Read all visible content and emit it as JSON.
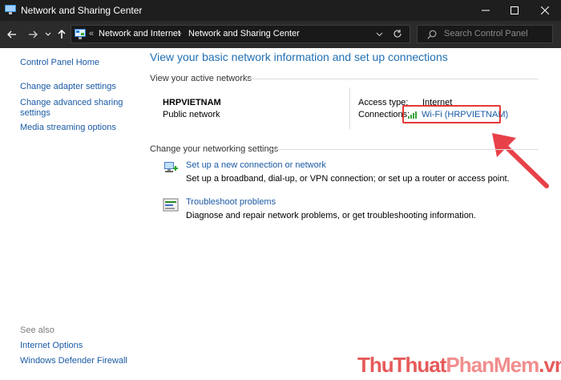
{
  "window": {
    "title": "Network and Sharing Center"
  },
  "address_bar": {
    "crumb_sep": "«",
    "crumbs": [
      "Network and Internet",
      "Network and Sharing Center"
    ],
    "search_placeholder": "Search Control Panel"
  },
  "sidebar": {
    "links": [
      "Control Panel Home",
      "Change adapter settings",
      "Change advanced sharing",
      "settings",
      "Media streaming options"
    ],
    "see_also_label": "See also",
    "see_also": [
      "Internet Options",
      "Windows Defender Firewall"
    ]
  },
  "main": {
    "heading": "View your basic network information and set up connections",
    "active_networks_label": "View your active networks",
    "network_name": "HRPVIETNAM",
    "network_type": "Public network",
    "access_type_label": "Access type:",
    "access_type_value": "Internet",
    "connections_label": "Connections:",
    "connection_name": "Wi-Fi (HRPVIETNAM)",
    "change_settings_label": "Change your networking settings",
    "tasks": [
      {
        "title": "Set up a new connection or network",
        "desc": "Set up a broadband, dial-up, or VPN connection; or set up a router or access point."
      },
      {
        "title": "Troubleshoot problems",
        "desc": "Diagnose and repair network problems, or get troubleshooting information."
      }
    ]
  },
  "watermark": {
    "part1": "ThuThuat",
    "part2": "PhanMem",
    "part3": ".vn"
  },
  "colors": {
    "accent_red": "#e53935",
    "link_blue": "#1a5aa5",
    "heading_blue": "#1e6fb3"
  }
}
